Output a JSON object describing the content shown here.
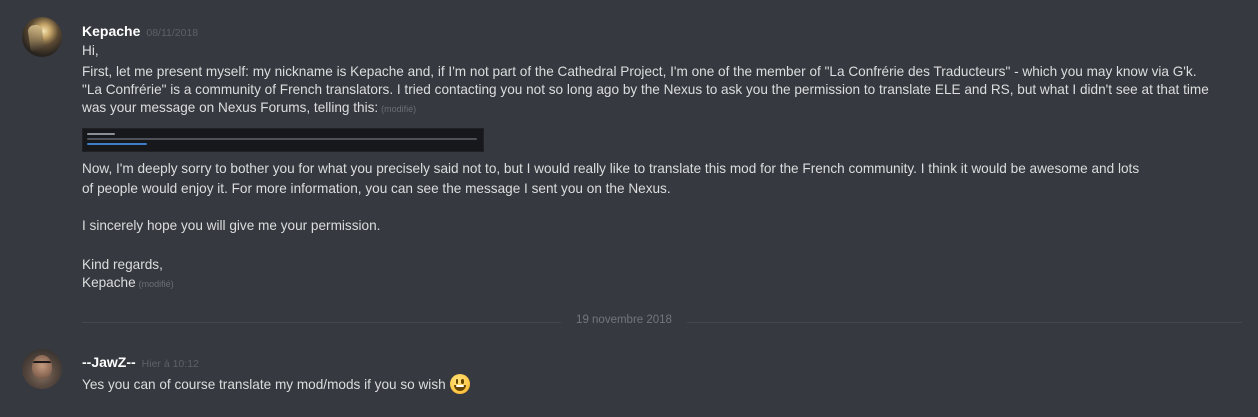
{
  "messages": [
    {
      "username": "Kepache",
      "timestamp": "08/11/2018",
      "lines": [
        "Hi,",
        "First, let me present myself: my nickname is Kepache and, if I'm not part of the Cathedral Project, I'm one of the member of \"La Confrérie des Traducteurs\" - which you may know via G'k.",
        "\"La Confrérie\" is a community of French translators. I tried contacting you not so long ago by the Nexus to ask you the permission to translate ELE and RS, but what I didn't see at that time",
        "was your message on Nexus Forums, telling this:",
        "Now, I'm deeply sorry to bother you for what you precisely said not to, but I would really like to translate this mod for the French community. I think it would be awesome and lots",
        "of people would enjoy it. For more information, you can see the message I sent you on the Nexus.",
        "I sincerely hope you will give me your permission.",
        "Kind regards,",
        "Kepache"
      ],
      "edited_label": "(modifié)",
      "image_edited_label": "(modifié)"
    },
    {
      "username": "--JawZ--",
      "timestamp": "Hier à 10:12",
      "lines": [
        "Yes you can of course translate my mod/mods if you so wish"
      ],
      "emoji": "smiley-emoji"
    }
  ],
  "divider": {
    "date": "19 novembre 2018"
  },
  "colors": {
    "background": "#36393f",
    "username": "#ffffff",
    "text": "#dcddde",
    "timestamp": "#5e6167",
    "divider": "#44474d"
  }
}
